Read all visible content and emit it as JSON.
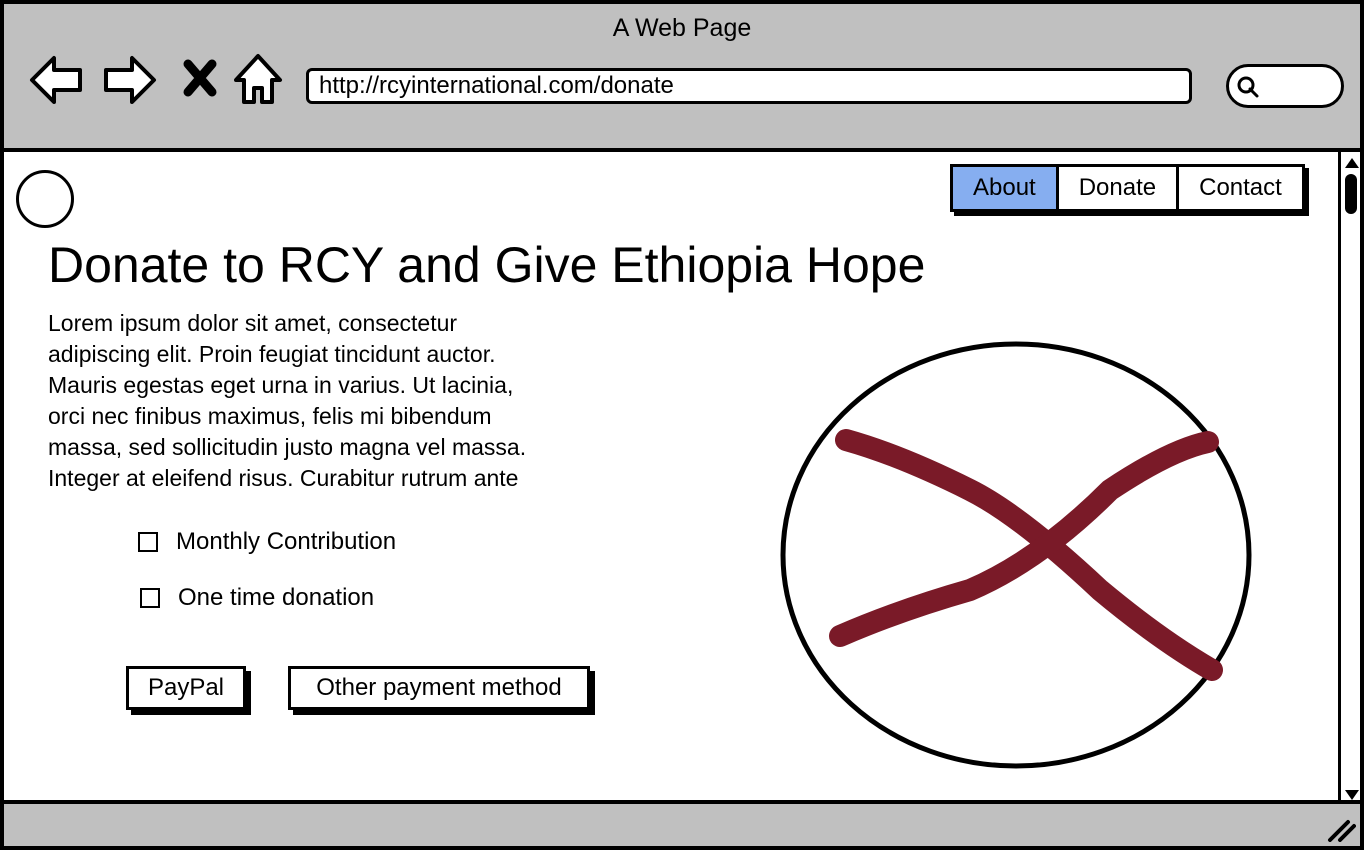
{
  "window": {
    "title": "A Web Page"
  },
  "toolbar": {
    "back_icon": "arrow-left-icon",
    "forward_icon": "arrow-right-icon",
    "stop_icon": "close-icon",
    "home_icon": "home-icon",
    "url": "http://rcyinternational.com/donate",
    "search_icon": "search-icon"
  },
  "nav": {
    "items": [
      {
        "label": "About",
        "active": true
      },
      {
        "label": "Donate",
        "active": false
      },
      {
        "label": "Contact",
        "active": false
      }
    ]
  },
  "main": {
    "heading": "Donate to RCY and Give Ethiopia Hope",
    "paragraph_lines": [
      "Lorem ipsum dolor sit amet, consectetur",
      "adipiscing elit. Proin feugiat tincidunt auctor.",
      "Mauris egestas eget urna in varius. Ut lacinia,",
      "orci nec finibus maximus, felis mi bibendum",
      "massa, sed sollicitudin justo magna vel massa.",
      "Integer at eleifend risus. Curabitur rutrum ante"
    ],
    "options": [
      {
        "label": "Monthly Contribution",
        "checked": false
      },
      {
        "label": "One time donation",
        "checked": false
      }
    ],
    "buttons": {
      "paypal": "PayPal",
      "other": "Other payment method"
    },
    "image_placeholder_icon": "image-placeholder-icon"
  },
  "colors": {
    "active_tab": "#86aef0",
    "placeholder_x": "#7a1a28",
    "chrome": "#c0c0c0"
  }
}
